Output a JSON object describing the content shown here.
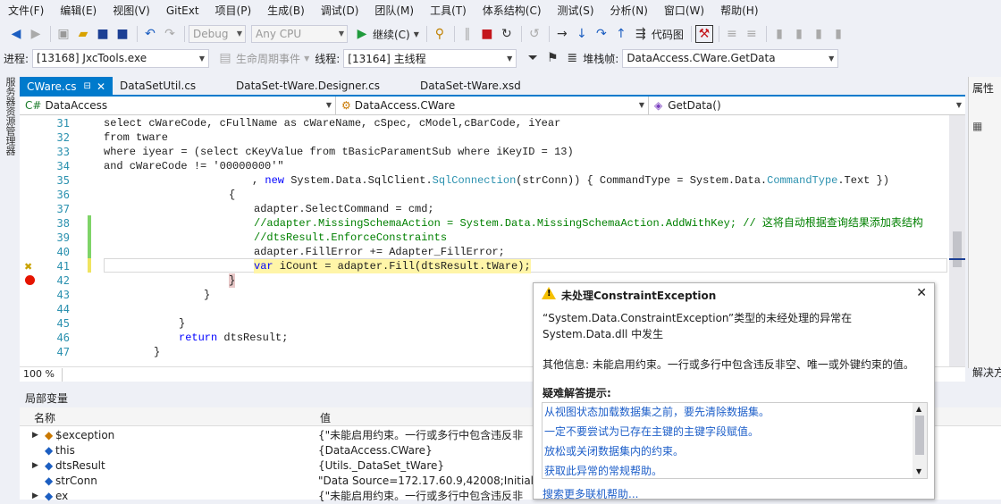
{
  "menu": [
    "文件(F)",
    "编辑(E)",
    "视图(V)",
    "GitExt",
    "项目(P)",
    "生成(B)",
    "调试(D)",
    "团队(M)",
    "工具(T)",
    "体系结构(C)",
    "测试(S)",
    "分析(N)",
    "窗口(W)",
    "帮助(H)"
  ],
  "toolbar": {
    "config": "Debug",
    "platform": "Any CPU",
    "continue": "继续(C)",
    "code_map": "代码图"
  },
  "debugbar": {
    "process_label": "进程:",
    "process_value": "[13168] JxcTools.exe",
    "lifecycle": "生命周期事件",
    "thread_label": "线程:",
    "thread_value": "[13164] 主线程",
    "stack_label": "堆栈帧:",
    "stack_value": "DataAccess.CWare.GetData"
  },
  "left_tab": "服务器资源管理器",
  "tabs": [
    "CWare.cs",
    "DataSetUtil.cs",
    "DataSet-tWare.Designer.cs",
    "DataSet-tWare.xsd"
  ],
  "nav": {
    "project": "DataAccess",
    "class": "DataAccess.CWare",
    "method": "GetData()"
  },
  "right_panel": {
    "title": "属性",
    "solution": "解决方"
  },
  "code": {
    "l31": "select cWareCode, cFullName as cWareName, cSpec, cModel,cBarCode, iYear",
    "l32": "from tware",
    "l33": "where iyear = (select cKeyValue from tBasicParamentSub where iKeyID = 13)",
    "l34": "and cWareCode != '00000000'\"",
    "l35a": ", ",
    "l35b": "new",
    "l35c": " System.Data.SqlClient.",
    "l35d": "SqlConnection",
    "l35e": "(strConn)) { CommandType = System.Data.",
    "l35f": "CommandType",
    "l35g": ".Text })",
    "l36": "{",
    "l37": "adapter.SelectCommand = cmd;",
    "l38": "//adapter.MissingSchemaAction = System.Data.MissingSchemaAction.AddWithKey; // 这将自动根据查询结果添加表结构",
    "l39": "//dtsResult.EnforceConstraints",
    "l40": "adapter.FillError += Adapter_FillError;",
    "l41a": "var",
    "l41b": " iCount = adapter.Fill(dtsResult.tWare);",
    "l42": "}",
    "l43": "}",
    "l44": "",
    "l45": "}",
    "l46a": "return",
    "l46b": " dtsResult;",
    "l47": "}"
  },
  "line_numbers": [
    "31",
    "32",
    "33",
    "34",
    "35",
    "36",
    "37",
    "38",
    "39",
    "40",
    "41",
    "42",
    "43",
    "44",
    "45",
    "46",
    "47"
  ],
  "zoom": "100 %",
  "locals": {
    "title": "局部变量",
    "col_name": "名称",
    "col_value": "值",
    "rows": [
      {
        "name": "$exception",
        "value": "{\"未能启用约束。一行或多行中包含违反非"
      },
      {
        "name": "this",
        "value": "{DataAccess.CWare}"
      },
      {
        "name": "dtsResult",
        "value": "{Utils._DataSet_tWare}"
      },
      {
        "name": "strConn",
        "value": "\"Data Source=172.17.60.9,42008;Initial Catalog"
      },
      {
        "name": "ex",
        "value": "{\"未能启用约束。一行或多行中包含违反非"
      }
    ]
  },
  "exception": {
    "title": "未处理ConstraintException",
    "message": "“System.Data.ConstraintException”类型的未经处理的异常在 System.Data.dll 中发生",
    "info": "其他信息: 未能启用约束。一行或多行中包含违反非空、唯一或外键约束的值。",
    "tips_title": "疑难解答提示:",
    "tips": [
      "从视图状态加载数据集之前，要先清除数据集。",
      "一定不要尝试为已存在主键的主键字段赋值。",
      "放松或关闭数据集内的约束。",
      "获取此异常的常规帮助。"
    ],
    "more": "搜索更多联机帮助..."
  }
}
